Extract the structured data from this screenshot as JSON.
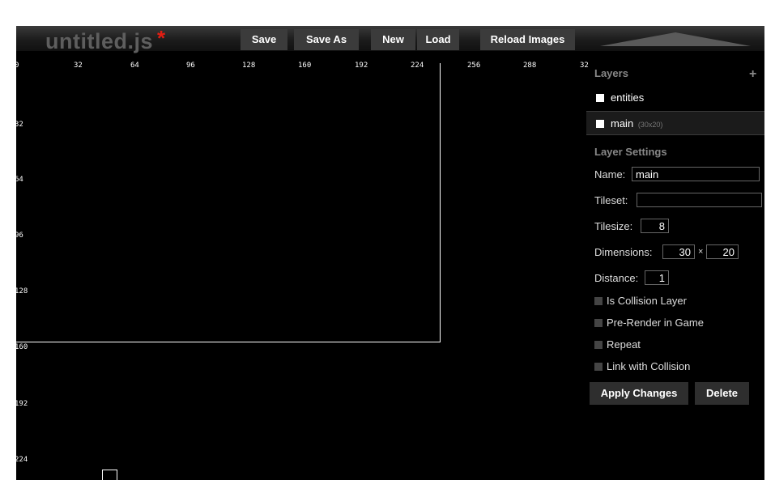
{
  "app": {
    "title": "untitled.js",
    "modified_marker": "*"
  },
  "toolbar": {
    "save": "Save",
    "save_as": "Save As",
    "new": "New",
    "load": "Load",
    "reload_images": "Reload Images"
  },
  "rulers": {
    "x": [
      "0",
      "32",
      "64",
      "96",
      "128",
      "160",
      "192",
      "224",
      "256",
      "288",
      "32"
    ],
    "y": [
      "32",
      "64",
      "96",
      "128",
      "160",
      "192",
      "224"
    ]
  },
  "layers_panel": {
    "title": "Layers",
    "add_icon": "+",
    "items": [
      {
        "name": "entities",
        "size": ""
      },
      {
        "name": "main",
        "size": "(30x20)"
      }
    ]
  },
  "layer_settings": {
    "title": "Layer Settings",
    "name_label": "Name:",
    "name_value": "main",
    "tileset_label": "Tileset:",
    "tileset_value": "",
    "tilesize_label": "Tilesize:",
    "tilesize_value": "8",
    "dimensions_label": "Dimensions:",
    "dim_x": "30",
    "dim_sep": "×",
    "dim_y": "20",
    "distance_label": "Distance:",
    "distance_value": "1",
    "is_collision": "Is Collision Layer",
    "prerender": "Pre-Render in Game",
    "repeat": "Repeat",
    "link_collision": "Link with Collision",
    "apply": "Apply Changes",
    "delete": "Delete"
  },
  "colors": {
    "accent": "#e21d12",
    "background": "#000000",
    "toolbar_button": "#3b3b3b"
  }
}
